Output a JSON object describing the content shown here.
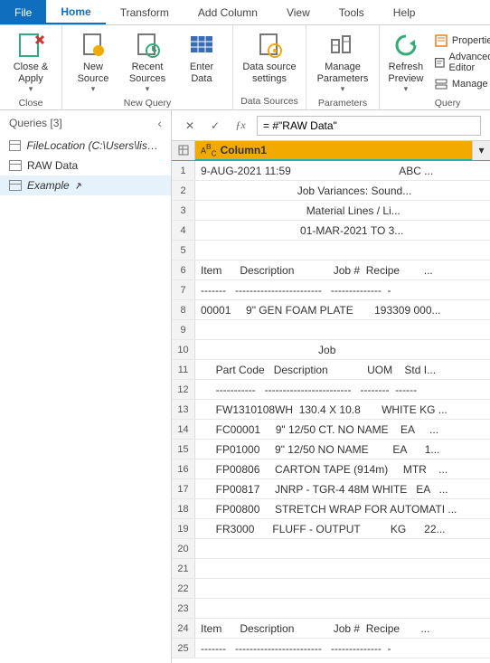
{
  "menubar": {
    "file": "File",
    "tabs": [
      "Home",
      "Transform",
      "Add Column",
      "View",
      "Tools",
      "Help"
    ],
    "active": 0
  },
  "ribbon": {
    "close": {
      "close_apply": "Close &\nApply",
      "group_label": "Close"
    },
    "new_query": {
      "new_source": "New\nSource",
      "recent_sources": "Recent\nSources",
      "enter_data": "Enter\nData",
      "group_label": "New Query"
    },
    "data_sources": {
      "data_source_settings": "Data source\nsettings",
      "group_label": "Data Sources"
    },
    "parameters": {
      "manage_parameters": "Manage\nParameters",
      "group_label": "Parameters"
    },
    "query": {
      "refresh_preview": "Refresh\nPreview",
      "properties": "Properties",
      "advanced_editor": "Advanced Editor",
      "manage": "Manage",
      "group_label": "Query"
    }
  },
  "queries": {
    "title": "Queries",
    "count": "[3]",
    "items": [
      {
        "label": "FileLocation (C:\\Users\\lisde...",
        "italic": true
      },
      {
        "label": "RAW Data",
        "italic": false
      },
      {
        "label": "Example",
        "italic": true,
        "selected": true
      }
    ]
  },
  "formula": {
    "value": "= #\"RAW Data\""
  },
  "column": {
    "type_label": "A B C",
    "name": "Column1"
  },
  "chart_data": {
    "type": "table",
    "columns": [
      "Column1"
    ],
    "rows": [
      {
        "n": 1,
        "v": "9-AUG-2021 11:59                                    ABC ..."
      },
      {
        "n": 2,
        "v": "                                Job Variances: Sound..."
      },
      {
        "n": 3,
        "v": "                                   Material Lines / Li..."
      },
      {
        "n": 4,
        "v": "                                 01-MAR-2021 TO 3..."
      },
      {
        "n": 5,
        "v": ""
      },
      {
        "n": 6,
        "v": "Item      Description             Job #  Recipe        ..."
      },
      {
        "n": 7,
        "v": "-------   ------------------------   --------------  -"
      },
      {
        "n": 8,
        "v": "00001     9\" GEN FOAM PLATE       193309 000..."
      },
      {
        "n": 9,
        "v": ""
      },
      {
        "n": 10,
        "v": "                                       Job"
      },
      {
        "n": 11,
        "v": "     Part Code   Description             UOM    Std I..."
      },
      {
        "n": 12,
        "v": "     -----------   ------------------------   --------  ------"
      },
      {
        "n": 13,
        "v": "     FW1310108WH  130.4 X 10.8       WHITE KG ..."
      },
      {
        "n": 14,
        "v": "     FC00001     9\" 12/50 CT. NO NAME    EA     ..."
      },
      {
        "n": 15,
        "v": "     FP01000     9\" 12/50 NO NAME        EA      1..."
      },
      {
        "n": 16,
        "v": "     FP00806     CARTON TAPE (914m)     MTR    ..."
      },
      {
        "n": 17,
        "v": "     FP00817     JNRP - TGR-4 48M WHITE   EA   ..."
      },
      {
        "n": 18,
        "v": "     FP00800     STRETCH WRAP FOR AUTOMATI ..."
      },
      {
        "n": 19,
        "v": "     FR3000      FLUFF - OUTPUT          KG      22..."
      },
      {
        "n": 20,
        "v": ""
      },
      {
        "n": 21,
        "v": ""
      },
      {
        "n": 22,
        "v": ""
      },
      {
        "n": 23,
        "v": ""
      },
      {
        "n": 24,
        "v": "Item      Description             Job #  Recipe       ..."
      },
      {
        "n": 25,
        "v": "-------   ------------------------   --------------  -"
      }
    ]
  }
}
